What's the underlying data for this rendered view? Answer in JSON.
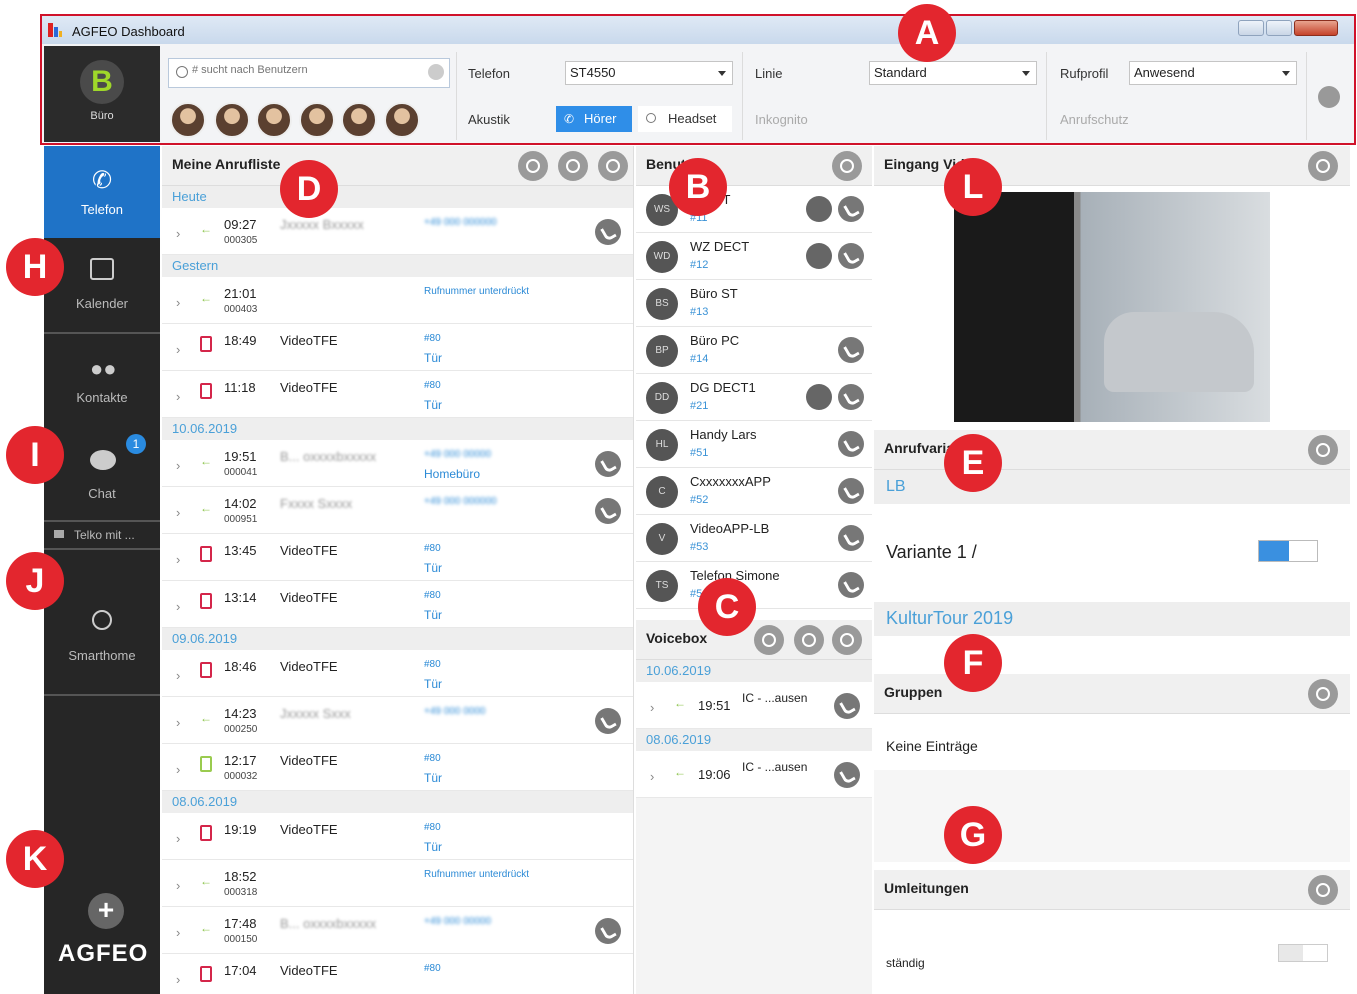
{
  "window": {
    "title": "AGFEO Dashboard"
  },
  "user": {
    "initial": "B",
    "label": "Büro"
  },
  "search": {
    "placeholder": "# sucht nach Benutzern"
  },
  "header": {
    "telefon_label": "Telefon",
    "telefon_value": "ST4550",
    "linie_label": "Linie",
    "linie_value": "Standard",
    "rufprofil_label": "Rufprofil",
    "rufprofil_value": "Anwesend",
    "akustik_label": "Akustik",
    "hoerer_label": "Hörer",
    "headset_label": "Headset",
    "inkognito_label": "Inkognito",
    "anrufschutz_label": "Anrufschutz"
  },
  "nav": {
    "telefon": "Telefon",
    "kalender": "Kalender",
    "kontakte": "Kontakte",
    "chat": "Chat",
    "chat_badge": "1",
    "telko": "Telko mit ...",
    "smarthome": "Smarthome",
    "logo": "AGFEO",
    "add": "+"
  },
  "calllist": {
    "title": "Meine Anrufliste",
    "groups": [
      {
        "label": "Heute",
        "rows": [
          {
            "time": "09:27",
            "dur": "000305",
            "name": "Jxxxxx Bxxxxx",
            "num": "+49 000 000000",
            "call": true
          }
        ]
      },
      {
        "label": "Gestern",
        "rows": [
          {
            "time": "21:01",
            "dur": "000403",
            "name": "",
            "num": "Rufnummer unterdrückt",
            "call": false
          },
          {
            "time": "18:49",
            "dur": "",
            "name": "VideoTFE",
            "num": "#80",
            "num2": "Tür",
            "door": true
          },
          {
            "time": "11:18",
            "dur": "",
            "name": "VideoTFE",
            "num": "#80",
            "num2": "Tür",
            "door": true
          }
        ]
      },
      {
        "label": "10.06.2019",
        "rows": [
          {
            "time": "19:51",
            "dur": "000041",
            "name": "B... oxxxxbxxxxx",
            "num": "+49 000 00000",
            "num2": "Homebüro",
            "call": true
          },
          {
            "time": "14:02",
            "dur": "000951",
            "name": "Fxxxx Sxxxx",
            "num": "+49 000 000000",
            "call": true
          },
          {
            "time": "13:45",
            "dur": "",
            "name": "VideoTFE",
            "num": "#80",
            "num2": "Tür",
            "door": true
          },
          {
            "time": "13:14",
            "dur": "",
            "name": "VideoTFE",
            "num": "#80",
            "num2": "Tür",
            "door": true
          }
        ]
      },
      {
        "label": "09.06.2019",
        "rows": [
          {
            "time": "18:46",
            "dur": "",
            "name": "VideoTFE",
            "num": "#80",
            "num2": "Tür",
            "door": true
          },
          {
            "time": "14:23",
            "dur": "000250",
            "name": "Jxxxxx Sxxx",
            "num": "+49 000 0000",
            "call": true
          },
          {
            "time": "12:17",
            "dur": "000032",
            "name": "VideoTFE",
            "num": "#80",
            "num2": "Tür",
            "door": true,
            "green": true
          }
        ]
      },
      {
        "label": "08.06.2019",
        "rows": [
          {
            "time": "19:19",
            "dur": "",
            "name": "VideoTFE",
            "num": "#80",
            "num2": "Tür",
            "door": true
          },
          {
            "time": "18:52",
            "dur": "000318",
            "name": "",
            "num": "Rufnummer unterdrückt",
            "call": false
          },
          {
            "time": "17:48",
            "dur": "000150",
            "name": "B... oxxxxbxxxxx",
            "num": "+49 000 00000",
            "call": true
          },
          {
            "time": "17:04",
            "dur": "",
            "name": "VideoTFE",
            "num": "#80",
            "door": true
          }
        ]
      }
    ]
  },
  "users": {
    "title": "Benutzer",
    "list": [
      {
        "av": "WS",
        "name": "WZ ST",
        "ext": "#11",
        "two": true
      },
      {
        "av": "WD",
        "name": "WZ DECT",
        "ext": "#12",
        "two": true
      },
      {
        "av": "BS",
        "name": "Büro ST",
        "ext": "#13",
        "two": false,
        "none": true
      },
      {
        "av": "BP",
        "name": "Büro PC",
        "ext": "#14",
        "two": false
      },
      {
        "av": "DD",
        "name": "DG DECT1",
        "ext": "#21",
        "two": true
      },
      {
        "av": "HL",
        "name": "Handy Lars",
        "ext": "#51",
        "two": false
      },
      {
        "av": "C",
        "name": "CxxxxxxxAPP",
        "ext": "#52",
        "two": false
      },
      {
        "av": "V",
        "name": "VideoAPP-LB",
        "ext": "#53",
        "two": false
      },
      {
        "av": "TS",
        "name": "Telefon Simone",
        "ext": "#54",
        "two": false
      }
    ]
  },
  "voicebox": {
    "title": "Voicebox",
    "groups": [
      {
        "label": "10.06.2019",
        "time": "19:51",
        "name": "IC - ...ausen"
      },
      {
        "label": "08.06.2019",
        "time": "19:06",
        "name": "IC - ...ausen"
      }
    ]
  },
  "eingang": {
    "title": "Eingang Video"
  },
  "anrufvarianten": {
    "title": "Anrufvarianten",
    "group1": "LB",
    "variante": "Variante 1 /",
    "group2": "KulturTour 2019"
  },
  "gruppen": {
    "title": "Gruppen",
    "empty": "Keine Einträge"
  },
  "umleitungen": {
    "title": "Umleitungen",
    "item": "ständig"
  },
  "markers": [
    "A",
    "B",
    "C",
    "D",
    "E",
    "F",
    "G",
    "H",
    "I",
    "J",
    "K",
    "L"
  ],
  "colors": {
    "accent": "#1f73c7",
    "marker": "#e3262e",
    "sidebar": "#262626"
  }
}
